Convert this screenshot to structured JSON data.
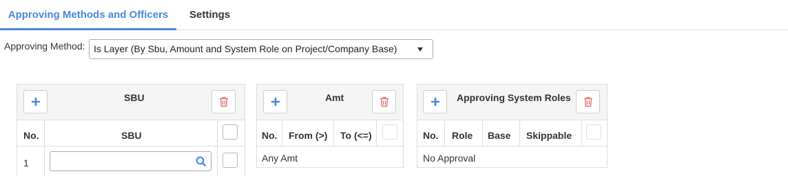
{
  "tabs": [
    {
      "label": "Approving Methods and Officers",
      "active": true
    },
    {
      "label": "Settings",
      "active": false
    }
  ],
  "approving_method": {
    "label": "Approving Method:",
    "selected": "Is Layer (By Sbu, Amount and System Role on Project/Company Base)"
  },
  "panels": {
    "sbu": {
      "title": "SBU",
      "columns": [
        "No.",
        "SBU"
      ],
      "rows": [
        {
          "no": "1",
          "sbu": ""
        }
      ]
    },
    "amt": {
      "title": "Amt",
      "columns": [
        "No.",
        "From (>)",
        "To (<=)"
      ],
      "rows": [
        {
          "text": "Any Amt"
        }
      ]
    },
    "roles": {
      "title": "Approving System Roles",
      "columns": [
        "No.",
        "Role",
        "Base",
        "Skippable"
      ],
      "rows": [
        {
          "text": "No Approval"
        }
      ]
    }
  },
  "icons": {
    "add": "plus-icon",
    "delete": "trash-icon",
    "search": "search-icon"
  },
  "colors": {
    "accent": "#4a86d9",
    "danger": "#e57373",
    "border": "#dddddd"
  }
}
